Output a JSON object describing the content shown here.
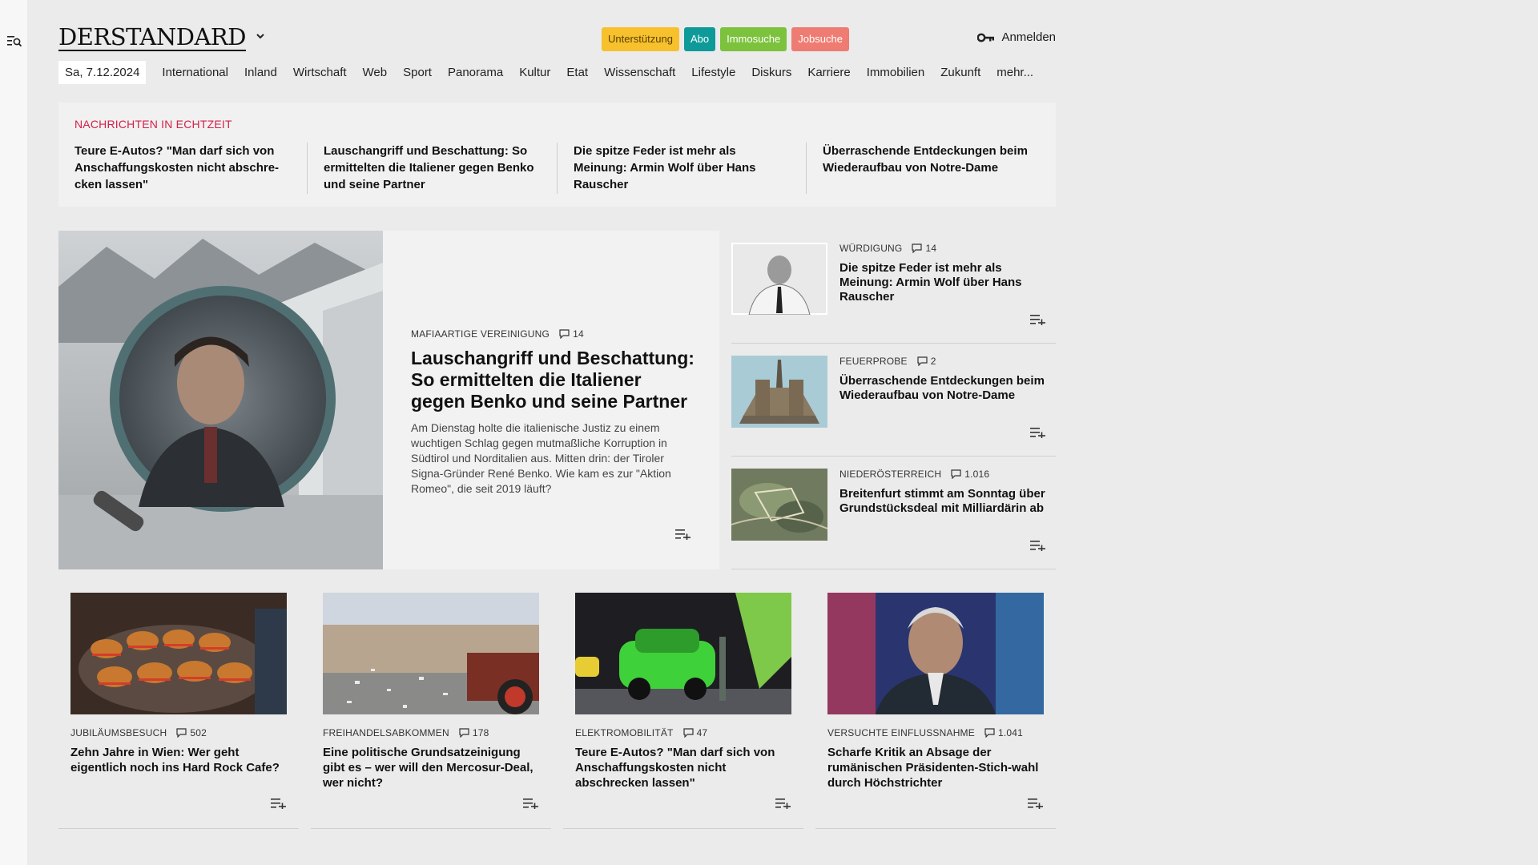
{
  "brand": {
    "logo": "DERSTANDARD"
  },
  "header": {
    "badges": [
      "Unterstützung",
      "Abo",
      "Immosuche",
      "Jobsuche"
    ],
    "login_label": "Anmelden"
  },
  "nav": {
    "date": "Sa, 7.12.2024",
    "items": [
      "International",
      "Inland",
      "Wirtschaft",
      "Web",
      "Sport",
      "Panorama",
      "Kultur",
      "Etat",
      "Wissenschaft",
      "Lifestyle",
      "Diskurs",
      "Karriere",
      "Immobilien",
      "Zukunft",
      "mehr..."
    ]
  },
  "live": {
    "label": "NACHRICHTEN IN ECHTZEIT",
    "items": [
      "Teure E-Autos? \"Man darf sich von Anschaffungskosten nicht abschre-cken lassen\"",
      "Lauschangriff und Beschattung: So ermittelten die Italiener gegen Benko und seine Partner",
      "Die spitze Feder ist mehr als Meinung: Armin Wolf über Hans Rauscher",
      "Überraschende Entdeckungen beim Wiederaufbau von Notre-Dame"
    ]
  },
  "hero": {
    "kicker": "MAFIAARTIGE VEREINIGUNG",
    "comments": "14",
    "title": "Lauschangriff und Beschattung: So ermittelten die Italiener gegen Benko und seine Partner",
    "teaser": "Am Dienstag holte die italienische Justiz zu einem wuchtigen Schlag gegen mutmaßliche Korruption in Südtirol und Norditalien aus. Mitten drin: der Tiroler Signa-Gründer René Benko. Wie kam es zur \"Aktion Romeo\", die seit 2019 läuft?"
  },
  "side": [
    {
      "kicker": "WÜRDIGUNG",
      "comments": "14",
      "title": "Die spitze Feder ist mehr als Meinung: Armin Wolf über Hans Rauscher"
    },
    {
      "kicker": "FEUERPROBE",
      "comments": "2",
      "title": "Überraschende Entdeckungen beim Wiederaufbau von Notre-Dame"
    },
    {
      "kicker": "NIEDERÖSTERREICH",
      "comments": "1.016",
      "title": "Breitenfurt stimmt am Sonntag über Grundstücksdeal mit Milliardärin ab"
    }
  ],
  "cards": [
    {
      "kicker": "JUBILÄUMSBESUCH",
      "comments": "502",
      "title": "Zehn Jahre in Wien: Wer geht eigentlich noch ins Hard Rock Cafe?"
    },
    {
      "kicker": "FREIHANDELSABKOMMEN",
      "comments": "178",
      "title": "Eine politische Grundsatzeinigung gibt es – wer will den Mercosur-Deal, wer nicht?"
    },
    {
      "kicker": "ELEKTROMOBILITÄT",
      "comments": "47",
      "title": "Teure E-Autos? \"Man darf sich von Anschaffungskosten nicht abschrecken lassen\""
    },
    {
      "kicker": "VERSUCHTE EINFLUSSNAHME",
      "comments": "1.041",
      "title": "Scharfe Kritik an Absage der rumänischen Präsidenten-Stich-wahl durch Höchstrichter"
    }
  ],
  "colors": {
    "live_label": "#d4204a",
    "badge_support": "#f7c12e",
    "badge_abo": "#0f9a9a",
    "badge_immo": "#7cc23d",
    "badge_jobs": "#ee7c72"
  }
}
